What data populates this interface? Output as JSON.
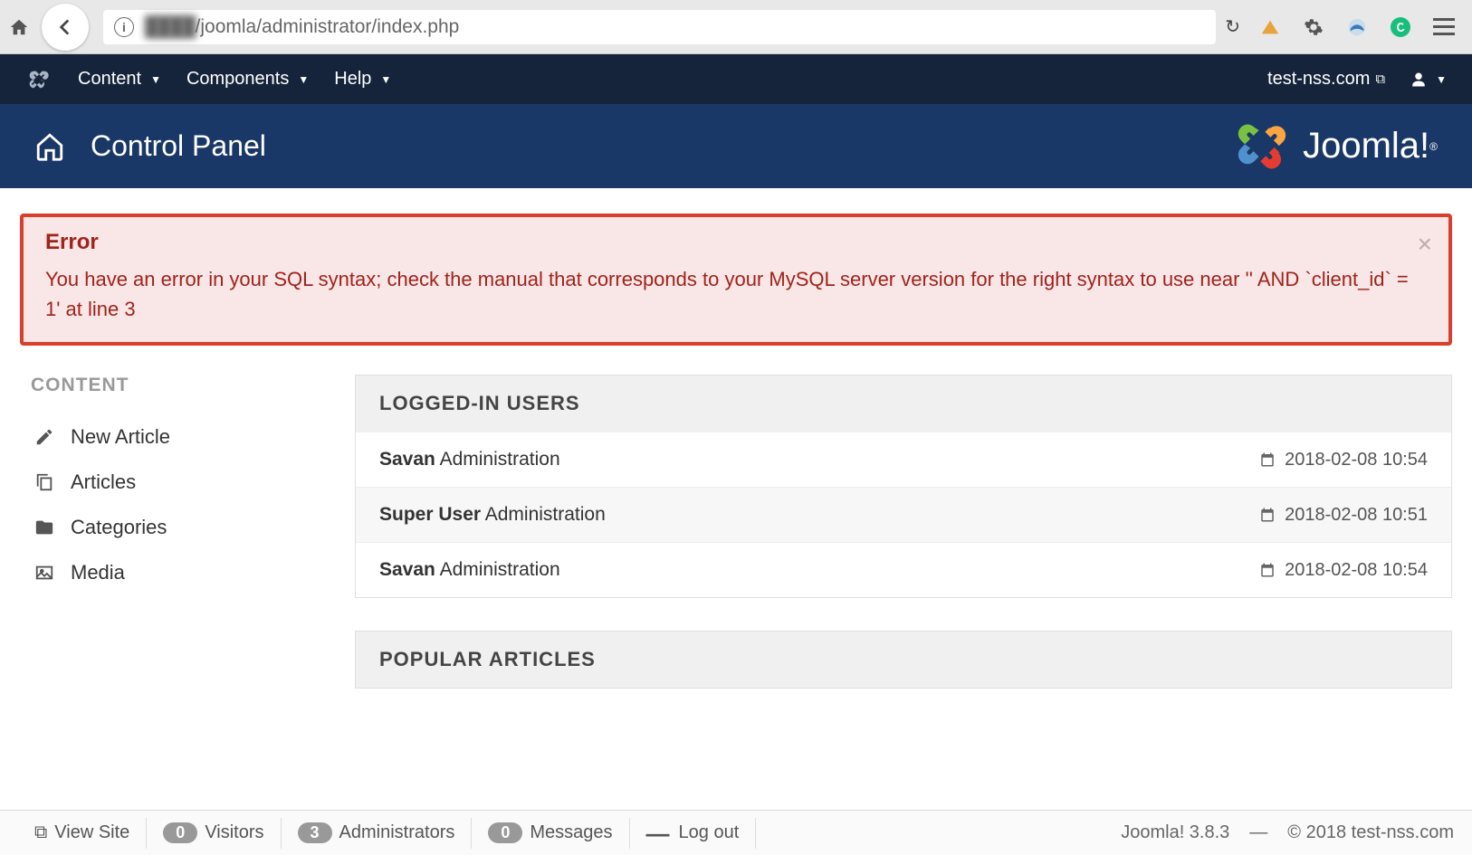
{
  "browser": {
    "url_visible": "/joomla/administrator/index.php"
  },
  "navbar": {
    "items": [
      "Content",
      "Components",
      "Help"
    ],
    "site_link": "test-nss.com"
  },
  "header": {
    "title": "Control Panel",
    "brand": "Joomla!"
  },
  "alert": {
    "title": "Error",
    "message": "You have an error in your SQL syntax; check the manual that corresponds to your MySQL server version for the right syntax to use near '' AND `client_id` = 1' at line 3"
  },
  "sidebar": {
    "section": "CONTENT",
    "items": [
      {
        "label": "New Article",
        "icon": "pencil"
      },
      {
        "label": "Articles",
        "icon": "copy"
      },
      {
        "label": "Categories",
        "icon": "folder"
      },
      {
        "label": "Media",
        "icon": "image"
      }
    ]
  },
  "panels": {
    "logged_in": {
      "title": "LOGGED-IN USERS",
      "rows": [
        {
          "name": "Savan",
          "area": "Administration",
          "time": "2018-02-08 10:54"
        },
        {
          "name": "Super User",
          "area": "Administration",
          "time": "2018-02-08 10:51"
        },
        {
          "name": "Savan",
          "area": "Administration",
          "time": "2018-02-08 10:54"
        }
      ]
    },
    "popular": {
      "title": "POPULAR ARTICLES"
    }
  },
  "footer": {
    "view_site": "View Site",
    "visitors": {
      "count": "0",
      "label": "Visitors"
    },
    "admins": {
      "count": "3",
      "label": "Administrators"
    },
    "messages": {
      "count": "0",
      "label": "Messages"
    },
    "logout": "Log out",
    "version": "Joomla! 3.8.3",
    "copyright": "© 2018 test-nss.com"
  }
}
